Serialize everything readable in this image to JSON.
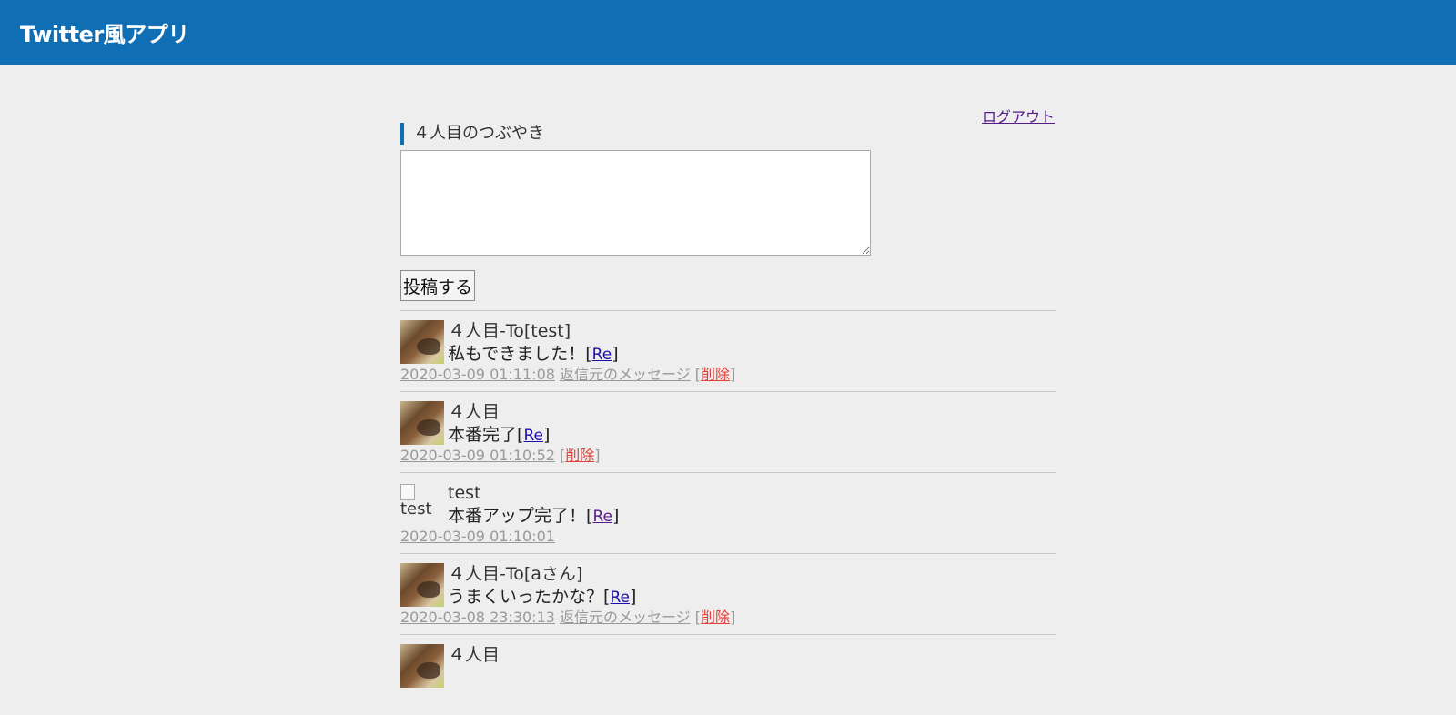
{
  "header": {
    "title": "Twitter風アプリ",
    "color": "#106eb5"
  },
  "logout_label": "ログアウト",
  "compose": {
    "heading": "４人目のつぶやき",
    "textarea_value": "",
    "submit_label": "投稿する"
  },
  "re_label": "Re",
  "reply_source_label": "返信元のメッセージ",
  "delete_label": "削除",
  "posts": [
    {
      "name": "４人目-To[test]",
      "message": "私もできました！",
      "timestamp": "2020-03-09 01:11:08",
      "has_reply_source": true,
      "has_delete": true,
      "avatar": "photo"
    },
    {
      "name": "４人目",
      "message": "本番完了",
      "timestamp": "2020-03-09 01:10:52",
      "has_reply_source": false,
      "has_delete": true,
      "avatar": "photo"
    },
    {
      "name": "test",
      "message": "本番アップ完了！",
      "timestamp": "2020-03-09 01:10:01",
      "has_reply_source": false,
      "has_delete": false,
      "avatar": "broken",
      "avatar_alt": "test"
    },
    {
      "name": "４人目-To[aさん]",
      "message": "うまくいったかな？",
      "timestamp": "2020-03-08 23:30:13",
      "has_reply_source": true,
      "has_delete": true,
      "avatar": "photo"
    },
    {
      "name": "４人目",
      "message": "",
      "timestamp": "",
      "has_reply_source": false,
      "has_delete": false,
      "avatar": "photo"
    }
  ]
}
